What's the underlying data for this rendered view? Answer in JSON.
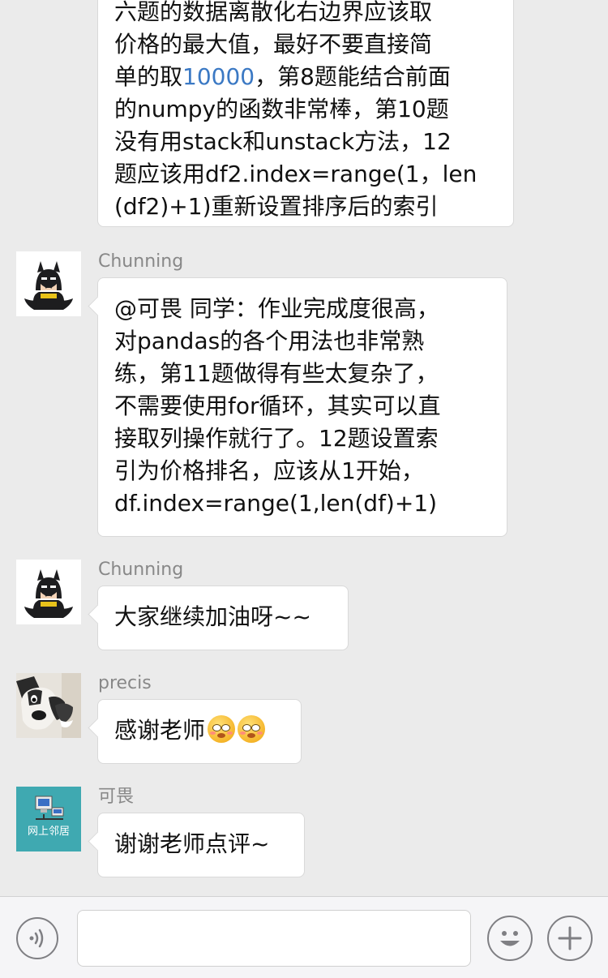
{
  "messages": [
    {
      "lines": [
        "六题的数据离散化右边界应该取",
        "价格的最大值，最好不要直接简",
        [
          "单的取",
          "10000",
          "，第8题能结合前面"
        ],
        "的numpy的函数非常棒，第10题",
        "没有用stack和unstack方法，12",
        "题应该用df2.index=range(1，len",
        "(df2)+1)重新设置排序后的索引"
      ]
    },
    {
      "sender": "Chunning",
      "lines": [
        "@可畏 同学：作业完成度很高，",
        "对pandas的各个用法也非常熟",
        "练，第11题做得有些太复杂了，",
        "不需要使用for循环，其实可以直",
        "接取列操作就行了。12题设置索",
        "引为价格排名，应该从1开始，",
        "df.index=range(1,len(df)+1)"
      ]
    },
    {
      "sender": "Chunning",
      "lines": [
        "大家继续加油呀~~"
      ]
    },
    {
      "sender": "precis",
      "lines": [
        "感谢老师"
      ],
      "emoji": [
        "blush-emoji",
        "blush-emoji"
      ]
    },
    {
      "sender": "可畏",
      "avatar_text": "网上邻居",
      "lines": [
        "谢谢老师点评~"
      ]
    }
  ],
  "input_bar": {
    "voice_icon": "voice-icon",
    "emoji_icon": "smiley-icon",
    "more_icon": "plus-icon",
    "input_value": ""
  },
  "colors": {
    "background": "#ebebeb",
    "bubble": "#ffffff",
    "link": "#3b79c4",
    "sender": "#888888"
  }
}
